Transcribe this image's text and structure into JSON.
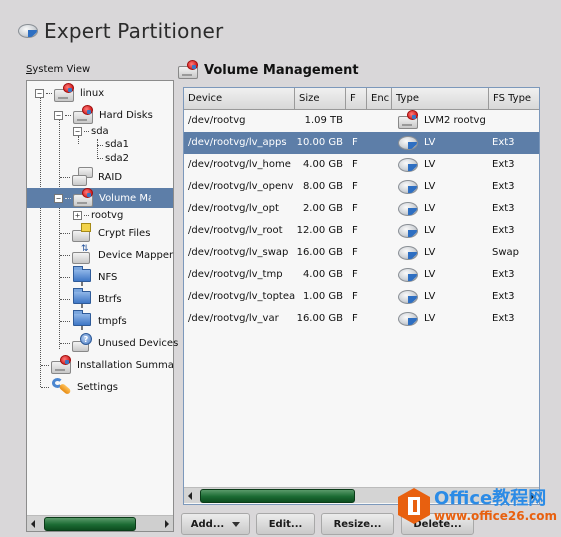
{
  "window": {
    "title": "Expert Partitioner"
  },
  "system_view": {
    "label": "System View",
    "label_mnemonic": "S",
    "tree": [
      {
        "label": "linux",
        "icon": "hard-disk-icon",
        "expanded": true,
        "level": 0
      },
      {
        "label": "Hard Disks",
        "icon": "hard-disk-icon",
        "expanded": true,
        "level": 1
      },
      {
        "label": "sda",
        "icon": "",
        "expanded": true,
        "level": 2
      },
      {
        "label": "sda1",
        "icon": "",
        "level": 3
      },
      {
        "label": "sda2",
        "icon": "",
        "level": 3
      },
      {
        "label": "RAID",
        "icon": "raid-icon",
        "level": 1
      },
      {
        "label": "Volume Management",
        "icon": "volume-icon",
        "expanded": true,
        "selected": true,
        "level": 1
      },
      {
        "label": "rootvg",
        "icon": "",
        "expanded": false,
        "level": 2
      },
      {
        "label": "Crypt Files",
        "icon": "crypt-icon",
        "level": 1
      },
      {
        "label": "Device Mapper",
        "icon": "device-mapper-icon",
        "level": 1
      },
      {
        "label": "NFS",
        "icon": "network-folder-icon",
        "level": 1
      },
      {
        "label": "Btrfs",
        "icon": "network-folder-icon",
        "level": 1
      },
      {
        "label": "tmpfs",
        "icon": "network-folder-icon",
        "level": 1
      },
      {
        "label": "Unused Devices",
        "icon": "unused-device-icon",
        "level": 1
      },
      {
        "label": "Installation Summary",
        "icon": "hard-disk-icon",
        "level": 0
      },
      {
        "label": "Settings",
        "icon": "settings-icon",
        "level": 0
      }
    ]
  },
  "main": {
    "title": "Volume Management",
    "columns": [
      "Device",
      "Size",
      "F",
      "Enc",
      "Type",
      "FS Type"
    ],
    "rows": [
      {
        "device": "/dev/rootvg",
        "size": "1.09 TB",
        "f": "",
        "enc": "",
        "type": "LVM2 rootvg",
        "type_icon": "volume-group-icon",
        "fs_type": "",
        "selected": false
      },
      {
        "device": "/dev/rootvg/lv_apps",
        "size": "10.00 GB",
        "f": "F",
        "enc": "",
        "type": "LV",
        "type_icon": "disc-icon",
        "fs_type": "Ext3",
        "selected": true
      },
      {
        "device": "/dev/rootvg/lv_home",
        "size": "4.00 GB",
        "f": "F",
        "enc": "",
        "type": "LV",
        "type_icon": "disc-icon",
        "fs_type": "Ext3",
        "selected": false
      },
      {
        "device": "/dev/rootvg/lv_openv",
        "size": "8.00 GB",
        "f": "F",
        "enc": "",
        "type": "LV",
        "type_icon": "disc-icon",
        "fs_type": "Ext3",
        "selected": false
      },
      {
        "device": "/dev/rootvg/lv_opt",
        "size": "2.00 GB",
        "f": "F",
        "enc": "",
        "type": "LV",
        "type_icon": "disc-icon",
        "fs_type": "Ext3",
        "selected": false
      },
      {
        "device": "/dev/rootvg/lv_root",
        "size": "12.00 GB",
        "f": "F",
        "enc": "",
        "type": "LV",
        "type_icon": "disc-icon",
        "fs_type": "Ext3",
        "selected": false
      },
      {
        "device": "/dev/rootvg/lv_swap",
        "size": "16.00 GB",
        "f": "F",
        "enc": "",
        "type": "LV",
        "type_icon": "disc-icon",
        "fs_type": "Swap",
        "selected": false
      },
      {
        "device": "/dev/rootvg/lv_tmp",
        "size": "4.00 GB",
        "f": "F",
        "enc": "",
        "type": "LV",
        "type_icon": "disc-icon",
        "fs_type": "Ext3",
        "selected": false
      },
      {
        "device": "/dev/rootvg/lv_toptea",
        "size": "1.00 GB",
        "f": "F",
        "enc": "",
        "type": "LV",
        "type_icon": "disc-icon",
        "fs_type": "Ext3",
        "selected": false
      },
      {
        "device": "/dev/rootvg/lv_var",
        "size": "16.00 GB",
        "f": "F",
        "enc": "",
        "type": "LV",
        "type_icon": "disc-icon",
        "fs_type": "Ext3",
        "selected": false
      }
    ]
  },
  "buttons": {
    "add": "Add...",
    "edit": "Edit...",
    "resize": "Resize...",
    "delete": "Delete..."
  },
  "watermark": {
    "title": "Office教程网",
    "url": "www.office26.com"
  },
  "colors": {
    "selection": "#5d7ea8",
    "scroll_thumb": "#1b6b33",
    "watermark_orange": "#e8600f",
    "watermark_blue": "#2b8be6"
  }
}
